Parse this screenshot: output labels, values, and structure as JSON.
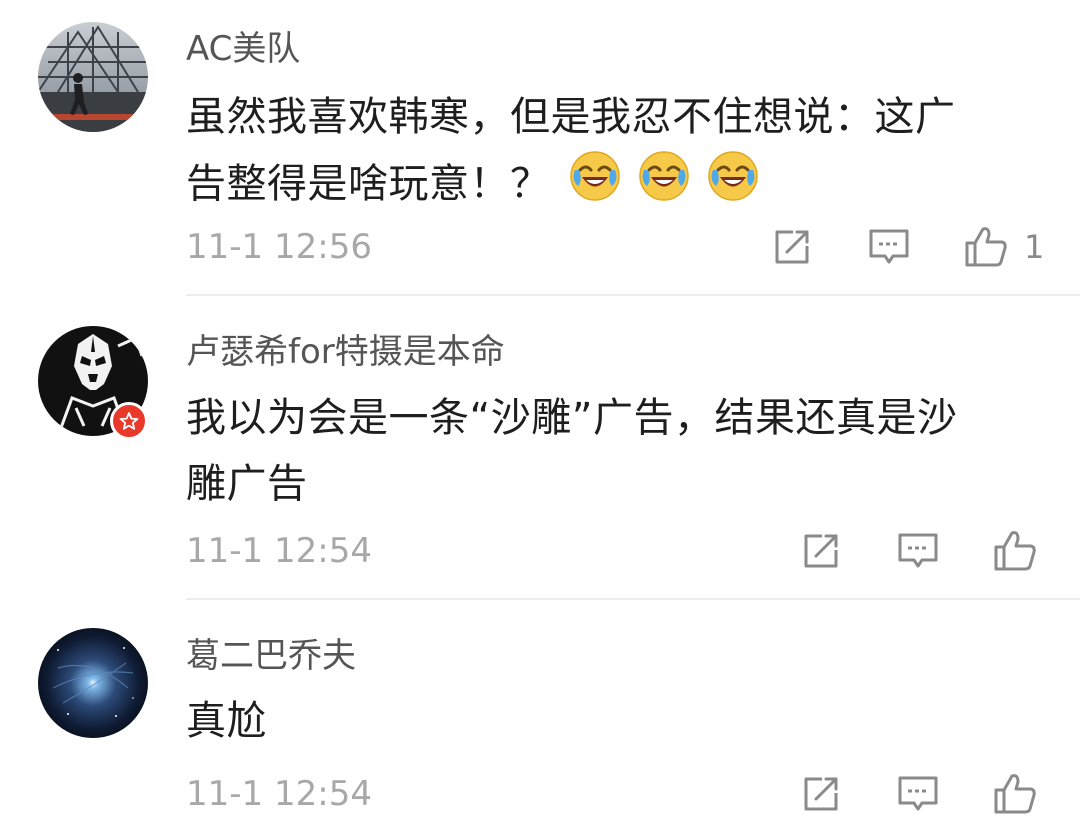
{
  "comments": [
    {
      "username": "AC美队",
      "content_line1": "虽然我喜欢韩寒，但是我忍不住想说：这广",
      "content_line2": "告整得是啥玩意！？",
      "time": "11-1 12:56",
      "like_count": "1",
      "emoji_count": 3,
      "avatar": "runner-photo",
      "has_badge": false
    },
    {
      "username": "卢瑟希for特摄是本命",
      "content_line1": "我以为会是一条“沙雕”广告，结果还真是沙",
      "content_line2": "雕广告",
      "time": "11-1 12:54",
      "like_count": "",
      "avatar": "masked-hero",
      "has_badge": true
    },
    {
      "username": "葛二巴乔夫",
      "content_line1": "真尬",
      "time": "11-1 12:54",
      "like_count": "",
      "avatar": "galaxy",
      "has_badge": false
    }
  ],
  "icons": {
    "share": "share-icon",
    "comment": "comment-icon",
    "like": "thumbs-up-icon",
    "emoji": "laughing-tears-emoji",
    "badge": "star-badge-icon"
  },
  "colors": {
    "username": "#555555",
    "text": "#1e1e1e",
    "time": "#a8a8a8",
    "icon": "#8a8a8a",
    "divider": "#ececec",
    "badge": "#e8392b"
  }
}
